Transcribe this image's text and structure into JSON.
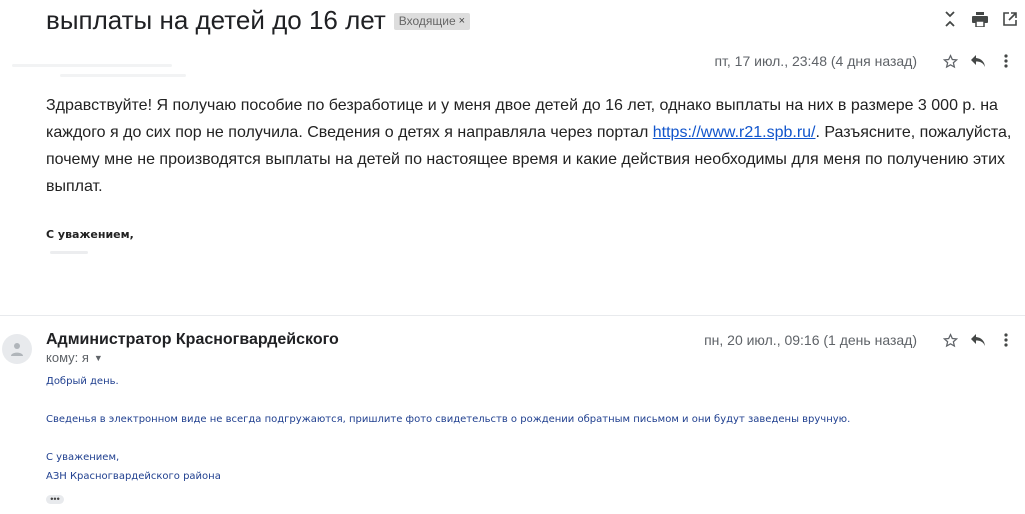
{
  "thread": {
    "subject": "выплаты на детей до 16 лет",
    "label": "Входящие",
    "label_remove": "×"
  },
  "toolbar": {
    "icons": [
      "collapse-all-icon",
      "print-icon",
      "open-new-window-icon"
    ]
  },
  "message1": {
    "date": "пт, 17 июл., 23:48 (4 дня назад)",
    "body_before_link": "Здравствуйте! Я получаю пособие по безработице и у меня двое детей до 16 лет, однако выплаты на них в размере 3 000 р. на каждого  я до сих пор не получила. Сведения о детях я направляла через портал ",
    "link": "https://www.r21.spb.ru/",
    "body_after_link": ". Разъясните, пожалуйста, почему мне не производятся выплаты на детей по настоящее время и какие действия необходимы для меня по получению этих выплат.",
    "signature": "С уважением,"
  },
  "message2": {
    "sender": "Администратор Красногвардейского",
    "to": "кому: я",
    "date": "пн, 20 июл., 09:16 (1 день назад)",
    "greeting": "Добрый день.",
    "text": "Сведенья в электронном виде не всегда подгружаются, пришлите фото свидетельств о рождении обратным письмом и они будут заведены вручную.",
    "closing": "С уважением,",
    "org": "АЗН Красногвардейского района",
    "ellipsis": "•••"
  },
  "colors": {
    "link": "#1155cc",
    "body2_text": "#1f3f8f",
    "label_bg": "#dddddd",
    "meta_text": "#5f6368"
  }
}
